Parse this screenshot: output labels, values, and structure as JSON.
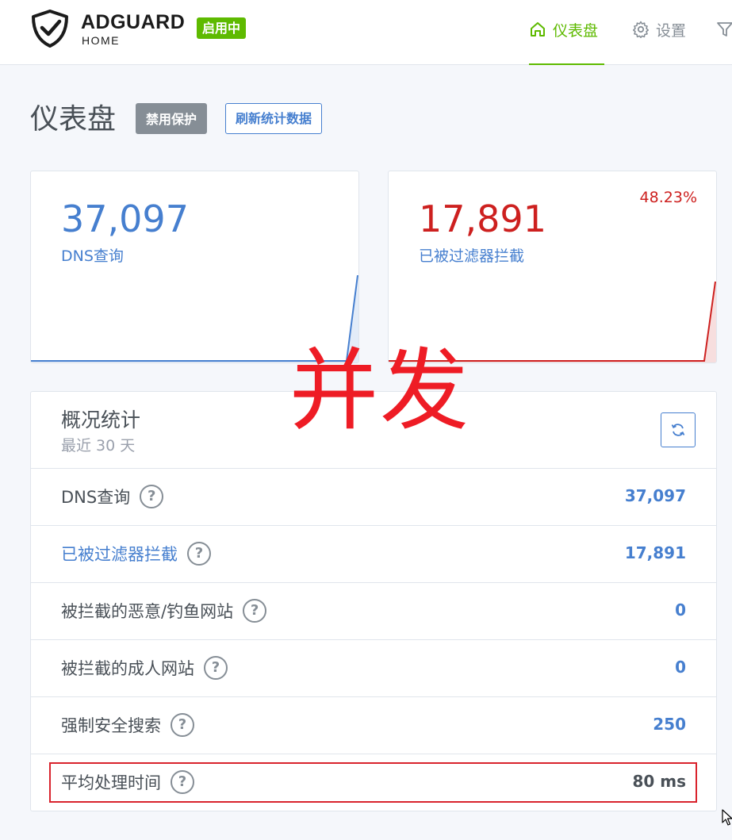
{
  "header": {
    "logo_title": "ADGUARD",
    "logo_sub": "HOME",
    "status_badge": "启用中",
    "nav": [
      {
        "label": "仪表盘",
        "icon": "home-icon"
      },
      {
        "label": "设置",
        "icon": "gear-icon"
      },
      {
        "label": "",
        "icon": "filter-icon"
      }
    ]
  },
  "page": {
    "title": "仪表盘",
    "disable_button": "禁用保护",
    "refresh_button": "刷新统计数据"
  },
  "cards": {
    "dns": {
      "value": "37,097",
      "label": "DNS查询",
      "color": "#467fcf"
    },
    "blocked": {
      "value": "17,891",
      "label": "已被过滤器拦截",
      "percent": "48.23%",
      "color": "#cd201f"
    }
  },
  "overlay_text": "并发",
  "general_stats": {
    "title": "概况统计",
    "subtitle": "最近 30 天",
    "rows": [
      {
        "label": "DNS查询",
        "value": "37,097"
      },
      {
        "label": "已被过滤器拦截",
        "value": "17,891"
      },
      {
        "label": "被拦截的恶意/钓鱼网站",
        "value": "0"
      },
      {
        "label": "被拦截的成人网站",
        "value": "0"
      },
      {
        "label": "强制安全搜索",
        "value": "250"
      },
      {
        "label": "平均处理时间",
        "value": "80 ms"
      }
    ]
  },
  "colors": {
    "accent": "#5eba00",
    "primary": "#467fcf",
    "danger": "#cd201f",
    "highlight": "#d9232d"
  }
}
